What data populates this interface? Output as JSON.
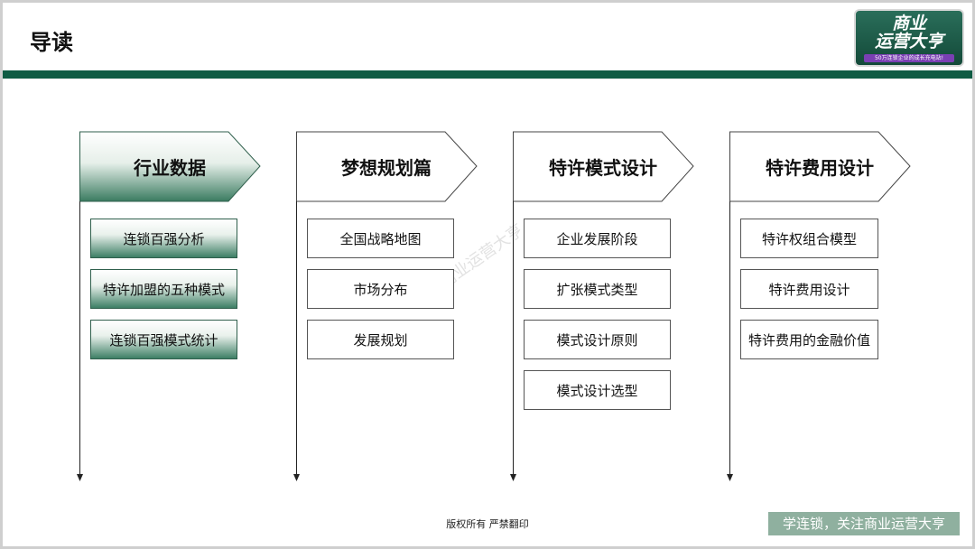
{
  "page_title": "导读",
  "logo": {
    "line1": "商业",
    "line2": "运营大亨",
    "tagline": "50万连锁企业的成长充电站!"
  },
  "watermark": "商业运营大亨",
  "footer": {
    "copyright": "版权所有 严禁翻印",
    "badge": "学连锁，关注商业运营大亨"
  },
  "colors": {
    "brand_green": "#0f5c44",
    "active_gradient_end": "#3d7f65",
    "badge_bg": "#8fb09f"
  },
  "columns": [
    {
      "title": "行业数据",
      "active": true,
      "items": [
        "连锁百强分析",
        "特许加盟的五种模式",
        "连锁百强模式统计"
      ]
    },
    {
      "title": "梦想规划篇",
      "active": false,
      "items": [
        "全国战略地图",
        "市场分布",
        "发展规划"
      ]
    },
    {
      "title": "特许模式设计",
      "active": false,
      "items": [
        "企业发展阶段",
        "扩张模式类型",
        "模式设计原则",
        "模式设计选型"
      ]
    },
    {
      "title": "特许费用设计",
      "active": false,
      "items": [
        "特许权组合模型",
        "特许费用设计",
        "特许费用的金融价值"
      ]
    }
  ]
}
